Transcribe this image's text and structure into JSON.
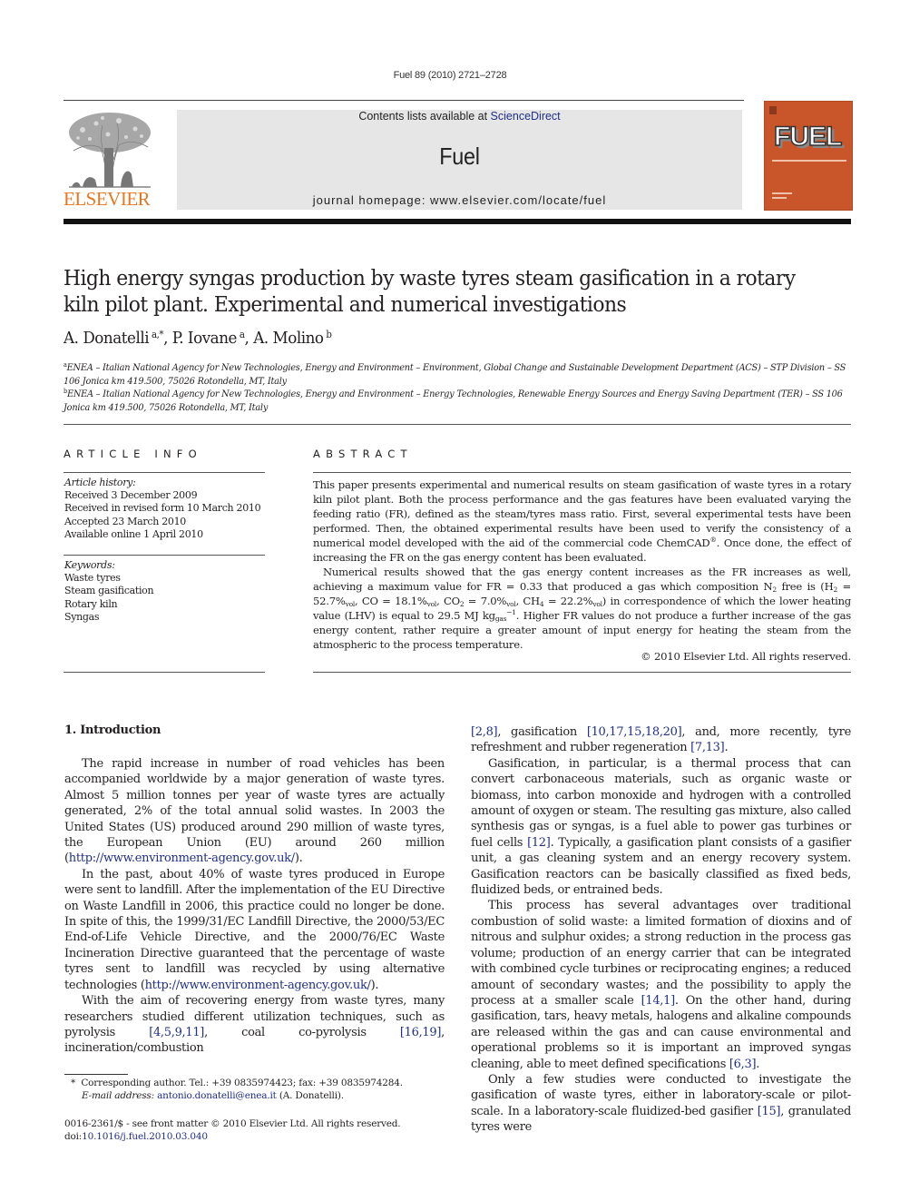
{
  "header": {
    "journal_ref": "Fuel 89 (2010) 2721–2728",
    "contents_prefix": "Contents lists available at ",
    "contents_link": "ScienceDirect",
    "journal_title": "Fuel",
    "homepage": "journal homepage: www.elsevier.com/locate/fuel",
    "publisher_logo_text": "ELSEVIER",
    "cover_title": "FUEL",
    "colors": {
      "elsevier_orange": "#e87722",
      "cover_orange": "#c8562a",
      "link_blue": "#1f2f8a",
      "masthead_gray": "#e6e6e6"
    }
  },
  "article": {
    "title_line1": "High energy syngas production by waste tyres steam gasification in a rotary",
    "title_line2": "kiln pilot plant. Experimental and numerical investigations",
    "authors": [
      {
        "name": "A. Donatelli",
        "sup": "a,*"
      },
      {
        "name": "P. Iovane",
        "sup": "a"
      },
      {
        "name": "A. Molino",
        "sup": "b"
      }
    ],
    "affiliations": [
      {
        "mark": "a",
        "text": "ENEA – Italian National Agency for New Technologies, Energy and Environment – Environment, Global Change and Sustainable Development Department (ACS) – STP Division – SS 106 Jonica km 419.500, 75026 Rotondella, MT, Italy"
      },
      {
        "mark": "b",
        "text": "ENEA – Italian National Agency for New Technologies, Energy and Environment – Energy Technologies, Renewable Energy Sources and Energy Saving Department (TER) – SS 106 Jonica km 419.500, 75026 Rotondella, MT, Italy"
      }
    ]
  },
  "article_info": {
    "heading": "ARTICLE INFO",
    "history_label": "Article history:",
    "history": [
      "Received 3 December 2009",
      "Received in revised form 10 March 2010",
      "Accepted 23 March 2010",
      "Available online 1 April 2010"
    ],
    "keywords_label": "Keywords:",
    "keywords": [
      "Waste tyres",
      "Steam gasification",
      "Rotary kiln",
      "Syngas"
    ]
  },
  "abstract": {
    "heading": "ABSTRACT",
    "p1_a": "This paper presents experimental and numerical results on steam gasification of waste tyres in a rotary kiln pilot plant. Both the process performance and the gas features have been evaluated varying the feeding ratio (FR), defined as the steam/tyres mass ratio. First, several experimental tests have been performed. Then, the obtained experimental results have been used to verify the consistency of a numerical model developed with the aid of the commercial code ChemCAD",
    "p1_reg": "®",
    "p1_b": ". Once done, the effect of increasing the FR on the gas energy content has been evaluated.",
    "p2": {
      "t1": "Numerical results showed that the gas energy content increases as the FR increases as well, achieving a maximum value for FR = 0.33 that produced a gas which composition N",
      "n2_sub": "2",
      "t2": " free is (H",
      "h2_sub": "2",
      "t3": " = 52.7%",
      "vol": "vol",
      "t4": ", CO = 18.1%",
      "t5": ", CO",
      "co2_sub": "2",
      "t6": " = 7.0%",
      "t7": ", CH",
      "ch4_sub": "4",
      "t8": " = 22.2%",
      "t9": ") in correspondence of which the lower heating value (LHV) is equal to 29.5 MJ kg",
      "gas_sub": "gas",
      "exp": "−1",
      "t10": ". Higher FR values do not produce a further increase of the gas energy content, rather require a greater amount of input energy for heating the steam from the atmospheric to the process temperature."
    },
    "copyright": "© 2010 Elsevier Ltd. All rights reserved."
  },
  "body": {
    "section_heading": "1. Introduction",
    "left": {
      "p1_text": "The rapid increase in number of road vehicles has been accompanied worldwide by a major generation of waste tyres. Almost 5 million tonnes per year of waste tyres are actually generated, 2% of the total annual solid wastes. In 2003 the United States (US) produced around 290 million of waste tyres, the European Union (EU) around 260 million (",
      "p1_link": "http://www.environment-agency.gov.uk/",
      "p1_end": ").",
      "p2_text": "In the past, about 40% of waste tyres produced in Europe were sent to landfill. After the implementation of the EU Directive on Waste Landfill in 2006, this practice could no longer be done. In spite of this, the 1999/31/EC Landfill Directive, the 2000/53/EC End-of-Life Vehicle Directive, and the 2000/76/EC Waste Incineration Directive guaranteed that the percentage of waste tyres sent to landfill was recycled by using alternative technologies (",
      "p2_link": "http://www.environment-agency.gov.uk/",
      "p2_end": ").",
      "p3_text": "With the aim of recovering energy from waste tyres, many researchers studied different utilization techniques, such as pyrolysis ",
      "p3_ref1": "[4,5,9,11]",
      "p3_mid1": ", coal co-pyrolysis ",
      "p3_ref2": "[16,19]",
      "p3_mid2": ", incineration/combustion"
    },
    "right": {
      "c_ref1": "[2,8]",
      "c_t1": ", gasification ",
      "c_ref2": "[10,17,15,18,20]",
      "c_t2": ", and, more recently, tyre refreshment and rubber regeneration ",
      "c_ref3": "[7,13]",
      "c_t3": ".",
      "p2_text": "Gasification, in particular, is a thermal process that can convert carbonaceous materials, such as organic waste or biomass, into carbon monoxide and hydrogen with a controlled amount of oxygen or steam. The resulting gas mixture, also called synthesis gas or syngas, is a fuel able to power gas turbines or fuel cells ",
      "p2_ref": "[12]",
      "p2_end": ". Typically, a gasification plant consists of a gasifier unit, a gas cleaning system and an energy recovery system. Gasification reactors can be basically classified as fixed beds, fluidized beds, or entrained beds.",
      "p3_text": "This process has several advantages over traditional combustion of solid waste: a limited formation of dioxins and of nitrous and sulphur oxides; a strong reduction in the process gas volume; production of an energy carrier that can be integrated with combined cycle turbines or reciprocating engines; a reduced amount of secondary wastes; and the possibility to apply the process at a smaller scale ",
      "p3_ref1": "[14,1]",
      "p3_mid": ". On the other hand, during gasification, tars, heavy metals, halogens and alkaline compounds are released within the gas and can cause environmental and operational problems so it is important an improved syngas cleaning, able to meet defined specifications ",
      "p3_ref2": "[6,3]",
      "p3_end": ".",
      "p4_text": "Only a few studies were conducted to investigate the gasification of waste tyres, either in laboratory-scale or pilot-scale. In a laboratory-scale fluidized-bed gasifier ",
      "p4_ref": "[15]",
      "p4_end": ", granulated tyres were"
    }
  },
  "footnotes": {
    "star": "*",
    "corresponding": "Corresponding author. Tel.: +39 0835974423; fax: +39 0835974284.",
    "email_label": "E-mail address:",
    "email": "antonio.donatelli@enea.it",
    "email_owner": " (A. Donatelli).",
    "front_matter": "0016-2361/$ - see front matter © 2010 Elsevier Ltd. All rights reserved.",
    "doi_label": "doi:",
    "doi": "10.1016/j.fuel.2010.03.040"
  }
}
